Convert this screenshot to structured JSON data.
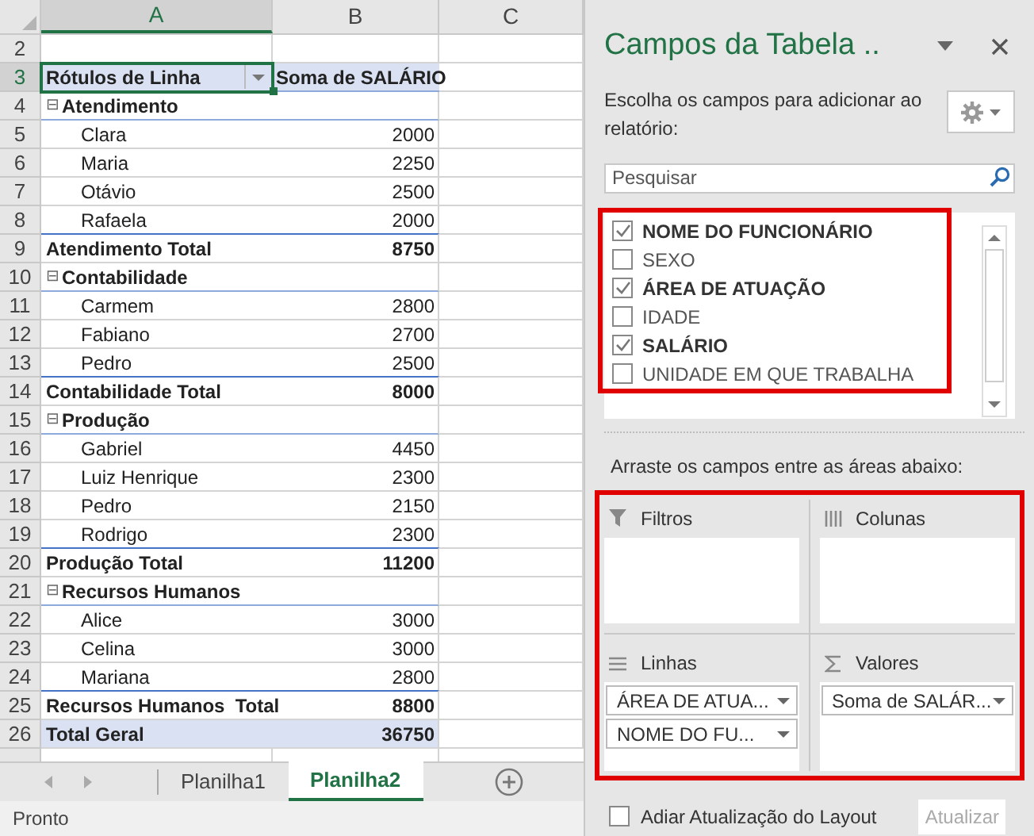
{
  "sheet": {
    "columns": [
      {
        "label": "A",
        "selected": true
      },
      {
        "label": "B",
        "selected": false
      },
      {
        "label": "C",
        "selected": false
      }
    ],
    "rows": [
      {
        "number": "2",
        "kind": "blank",
        "selected": false
      },
      {
        "number": "3",
        "kind": "header",
        "selected": true,
        "label": "Rótulos de Linha",
        "value": "Soma de SALÁRIO"
      },
      {
        "number": "4",
        "kind": "group",
        "selected": false,
        "label": "Atendimento",
        "toggle": "⊟"
      },
      {
        "number": "5",
        "kind": "item",
        "selected": false,
        "label": "Clara",
        "value": "2000"
      },
      {
        "number": "6",
        "kind": "item",
        "selected": false,
        "label": "Maria",
        "value": "2250"
      },
      {
        "number": "7",
        "kind": "item",
        "selected": false,
        "label": "Otávio",
        "value": "2500"
      },
      {
        "number": "8",
        "kind": "item",
        "selected": false,
        "label": "Rafaela",
        "value": "2000"
      },
      {
        "number": "9",
        "kind": "subtotal",
        "selected": false,
        "label": "Atendimento Total",
        "value": "8750"
      },
      {
        "number": "10",
        "kind": "group",
        "selected": false,
        "label": "Contabilidade",
        "toggle": "⊟"
      },
      {
        "number": "11",
        "kind": "item",
        "selected": false,
        "label": "Carmem",
        "value": "2800"
      },
      {
        "number": "12",
        "kind": "item",
        "selected": false,
        "label": "Fabiano",
        "value": "2700"
      },
      {
        "number": "13",
        "kind": "item",
        "selected": false,
        "label": "Pedro",
        "value": "2500"
      },
      {
        "number": "14",
        "kind": "subtotal",
        "selected": false,
        "label": "Contabilidade Total",
        "value": "8000"
      },
      {
        "number": "15",
        "kind": "group",
        "selected": false,
        "label": "Produção",
        "toggle": "⊟"
      },
      {
        "number": "16",
        "kind": "item",
        "selected": false,
        "label": "Gabriel",
        "value": "4450"
      },
      {
        "number": "17",
        "kind": "item",
        "selected": false,
        "label": "Luiz Henrique",
        "value": "2300"
      },
      {
        "number": "18",
        "kind": "item",
        "selected": false,
        "label": "Pedro",
        "value": "2150"
      },
      {
        "number": "19",
        "kind": "item",
        "selected": false,
        "label": "Rodrigo",
        "value": "2300"
      },
      {
        "number": "20",
        "kind": "subtotal",
        "selected": false,
        "label": "Produção Total",
        "value": "11200"
      },
      {
        "number": "21",
        "kind": "group",
        "selected": false,
        "label": "Recursos Humanos",
        "toggle": "⊟"
      },
      {
        "number": "22",
        "kind": "item",
        "selected": false,
        "label": "Alice",
        "value": "3000"
      },
      {
        "number": "23",
        "kind": "item",
        "selected": false,
        "label": "Celina",
        "value": "3000"
      },
      {
        "number": "24",
        "kind": "item",
        "selected": false,
        "label": "Mariana",
        "value": "2800"
      },
      {
        "number": "25",
        "kind": "subtotal",
        "selected": false,
        "label": "Recursos Humanos  Total",
        "value": "8800"
      },
      {
        "number": "26",
        "kind": "grand",
        "selected": false,
        "label": "Total Geral",
        "value": "36750"
      }
    ]
  },
  "sheet_tabs": [
    {
      "label": "Planilha1",
      "selected": false
    },
    {
      "label": "Planilha2",
      "selected": true
    }
  ],
  "status_bar": "Pronto",
  "panel": {
    "title": "Campos da Tabela ..",
    "description": "Escolha os campos para adicionar ao relatório:",
    "search": {
      "placeholder": "Pesquisar"
    },
    "fields": [
      {
        "label": "NOME DO FUNCIONÁRIO",
        "checked": true
      },
      {
        "label": "SEXO",
        "checked": false
      },
      {
        "label": "ÁREA DE ATUAÇÃO",
        "checked": true
      },
      {
        "label": "IDADE",
        "checked": false
      },
      {
        "label": "SALÁRIO",
        "checked": true
      },
      {
        "label": "UNIDADE EM QUE TRABALHA",
        "checked": false
      }
    ],
    "areas_hint": "Arraste os campos entre as áreas abaixo:",
    "areas": [
      {
        "kind": "filter",
        "label": "Filtros"
      },
      {
        "kind": "columns",
        "label": "Colunas"
      },
      {
        "kind": "rows",
        "label": "Linhas",
        "items": [
          "ÁREA DE ATUA...",
          "NOME DO FU..."
        ]
      },
      {
        "kind": "values",
        "label": "Valores",
        "items": [
          "Soma de SALÁR..."
        ]
      }
    ],
    "defer": {
      "label": "Adiar Atualização do Layout",
      "checked": false
    },
    "update_button": {
      "label": "Atualizar",
      "disabled": true
    }
  }
}
